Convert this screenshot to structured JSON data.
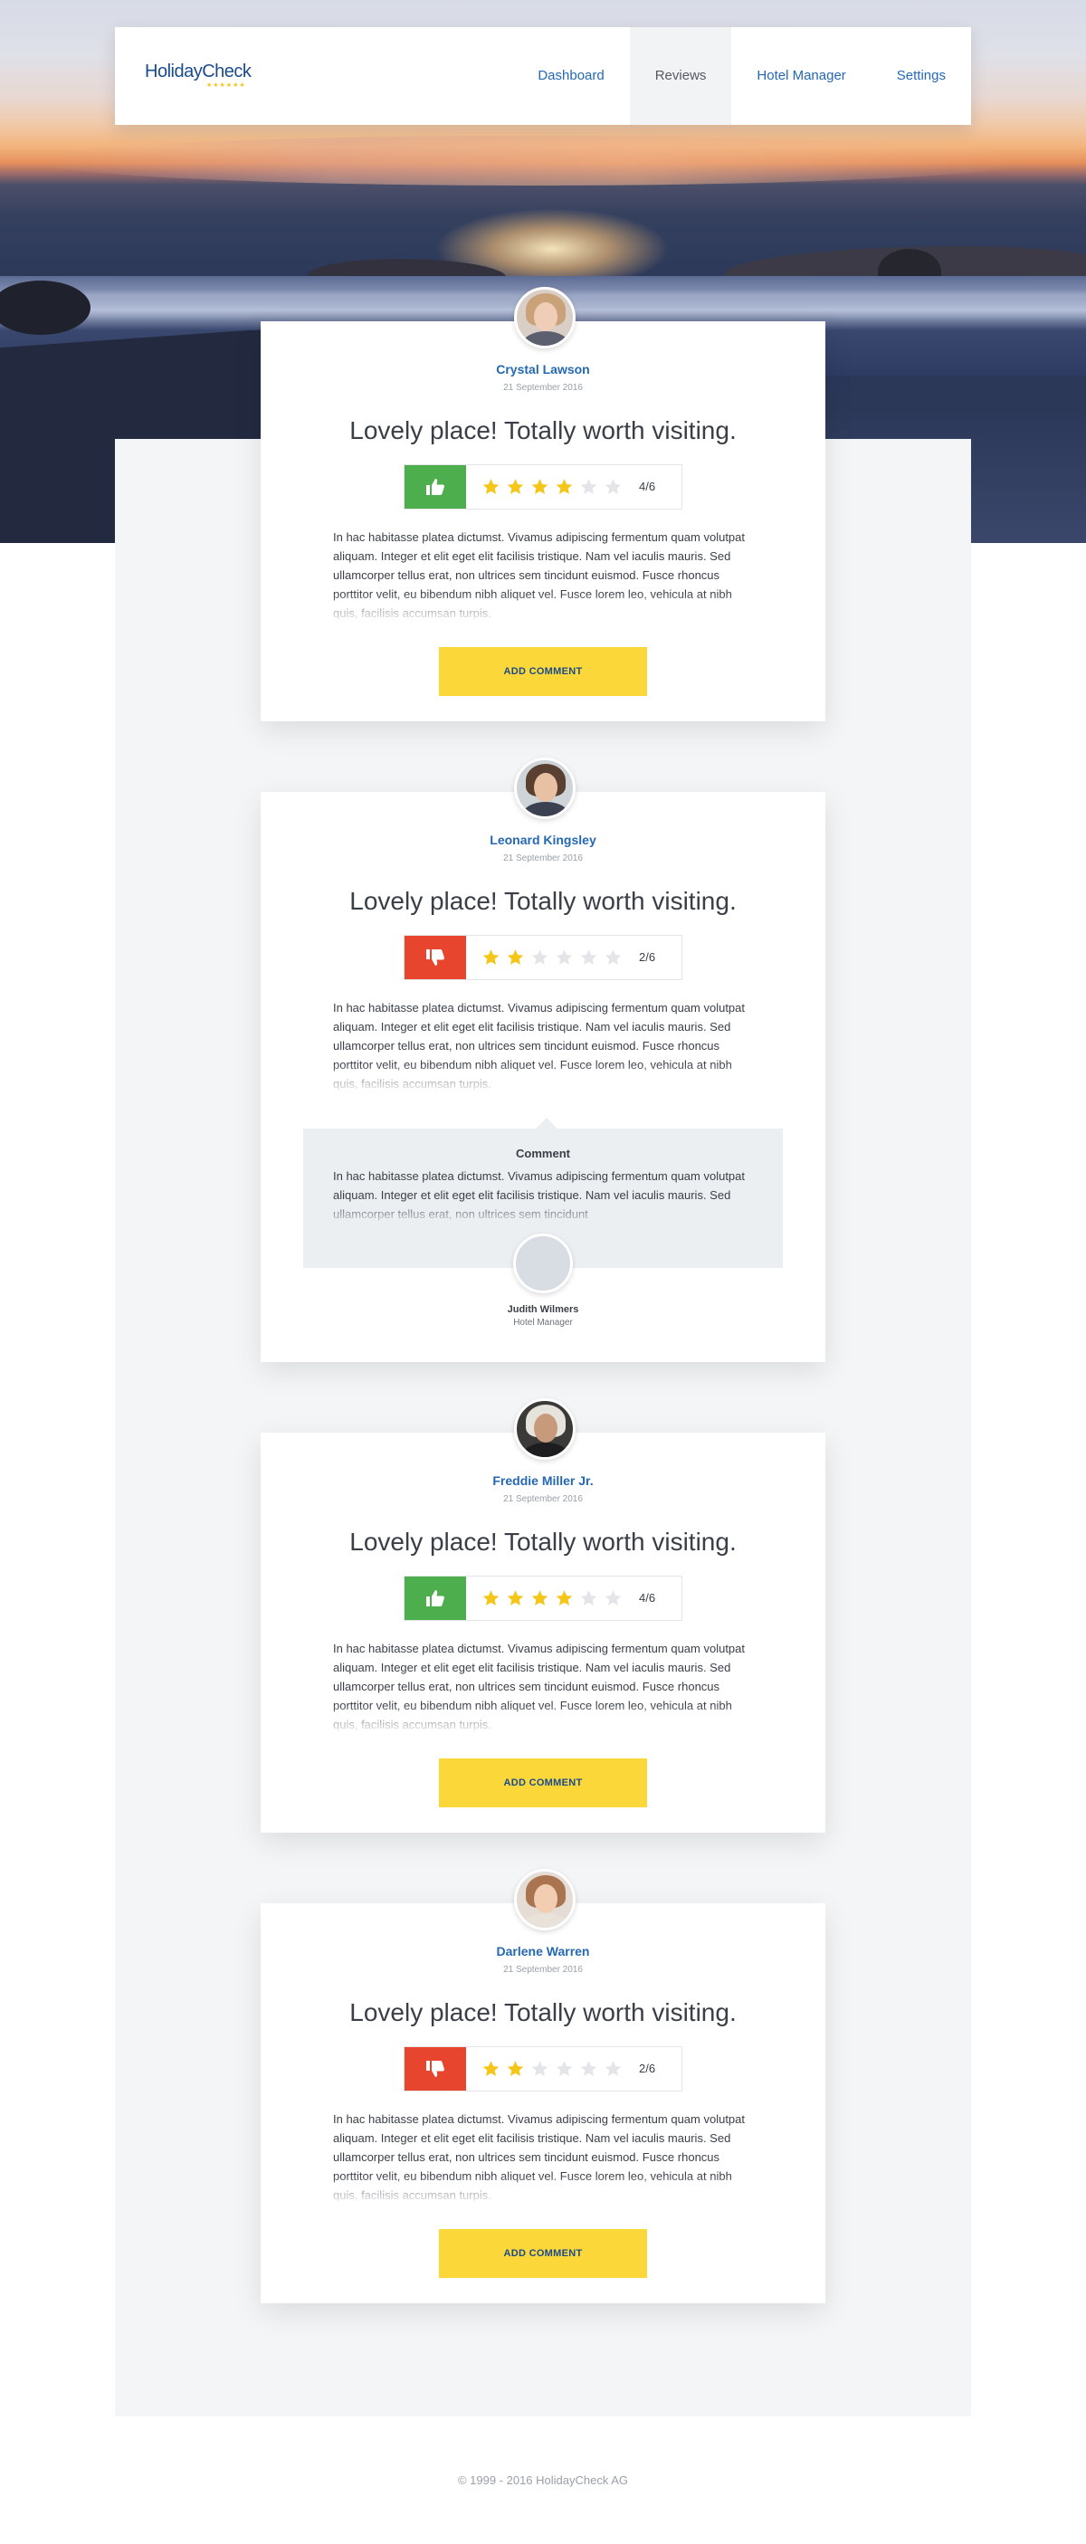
{
  "brand": {
    "logo_text": "HolidayCheck",
    "logo_stars": "★★★★★★"
  },
  "nav": {
    "items": [
      {
        "label": "Dashboard",
        "active": false
      },
      {
        "label": "Reviews",
        "active": true
      },
      {
        "label": "Hotel Manager",
        "active": false
      },
      {
        "label": "Settings",
        "active": false
      }
    ]
  },
  "colors": {
    "accent": "#2468b3",
    "button": "#fbd73a",
    "thumbs_up": "#4cae4c",
    "thumbs_down": "#e8452f",
    "star_on": "#f5c518",
    "star_off": "#e3e5e8"
  },
  "reviews": [
    {
      "name": "Crystal Lawson",
      "date": "21 September 2016",
      "title": "Lovely place! Totally worth visiting.",
      "verdict": "thumbs-up",
      "rating": 4,
      "rating_max": 6,
      "score_text": "4/6",
      "text": "In hac habitasse platea dictumst. Vivamus adipiscing fermentum quam volutpat aliquam. Integer et elit eget elit facilisis tristique. Nam vel iaculis mauris. Sed ullamcorper tellus erat, non ultrices sem tincidunt euismod. Fusce rhoncus porttitor velit, eu bibendum nibh aliquet vel. Fusce lorem leo, vehicula at nibh quis, facilisis accumsan turpis.",
      "button_label": "ADD COMMENT"
    },
    {
      "name": "Leonard Kingsley",
      "date": "21 September 2016",
      "title": "Lovely place! Totally worth visiting.",
      "verdict": "thumbs-down",
      "rating": 2,
      "rating_max": 6,
      "score_text": "2/6",
      "text": "In hac habitasse platea dictumst. Vivamus adipiscing fermentum quam volutpat aliquam. Integer et elit eget elit facilisis tristique. Nam vel iaculis mauris. Sed ullamcorper tellus erat, non ultrices sem tincidunt euismod. Fusce rhoncus porttitor velit, eu bibendum nibh aliquet vel. Fusce lorem leo, vehicula at nibh quis, facilisis accumsan turpis.",
      "comment": {
        "heading": "Comment",
        "text": "In hac habitasse platea dictumst. Vivamus adipiscing fermentum quam volutpat aliquam. Integer et elit eget elit facilisis tristique. Nam vel iaculis mauris. Sed ullamcorper tellus erat, non ultrices sem tincidunt",
        "author": "Judith Wilmers",
        "role": "Hotel Manager"
      }
    },
    {
      "name": "Freddie Miller Jr.",
      "date": "21 September 2016",
      "title": "Lovely place! Totally worth visiting.",
      "verdict": "thumbs-up",
      "rating": 4,
      "rating_max": 6,
      "score_text": "4/6",
      "text": "In hac habitasse platea dictumst. Vivamus adipiscing fermentum quam volutpat aliquam. Integer et elit eget elit facilisis tristique. Nam vel iaculis mauris. Sed ullamcorper tellus erat, non ultrices sem tincidunt euismod. Fusce rhoncus porttitor velit, eu bibendum nibh aliquet vel. Fusce lorem leo, vehicula at nibh quis, facilisis accumsan turpis.",
      "button_label": "ADD COMMENT"
    },
    {
      "name": "Darlene Warren",
      "date": "21 September 2016",
      "title": "Lovely place! Totally worth visiting.",
      "verdict": "thumbs-down",
      "rating": 2,
      "rating_max": 6,
      "score_text": "2/6",
      "text": "In hac habitasse platea dictumst. Vivamus adipiscing fermentum quam volutpat aliquam. Integer et elit eget elit facilisis tristique. Nam vel iaculis mauris. Sed ullamcorper tellus erat, non ultrices sem tincidunt euismod. Fusce rhoncus porttitor velit, eu bibendum nibh aliquet vel. Fusce lorem leo, vehicula at nibh quis, facilisis accumsan turpis.",
      "button_label": "ADD COMMENT"
    }
  ],
  "footer": {
    "copyright": "© 1999 - 2016 HolidayCheck AG"
  }
}
